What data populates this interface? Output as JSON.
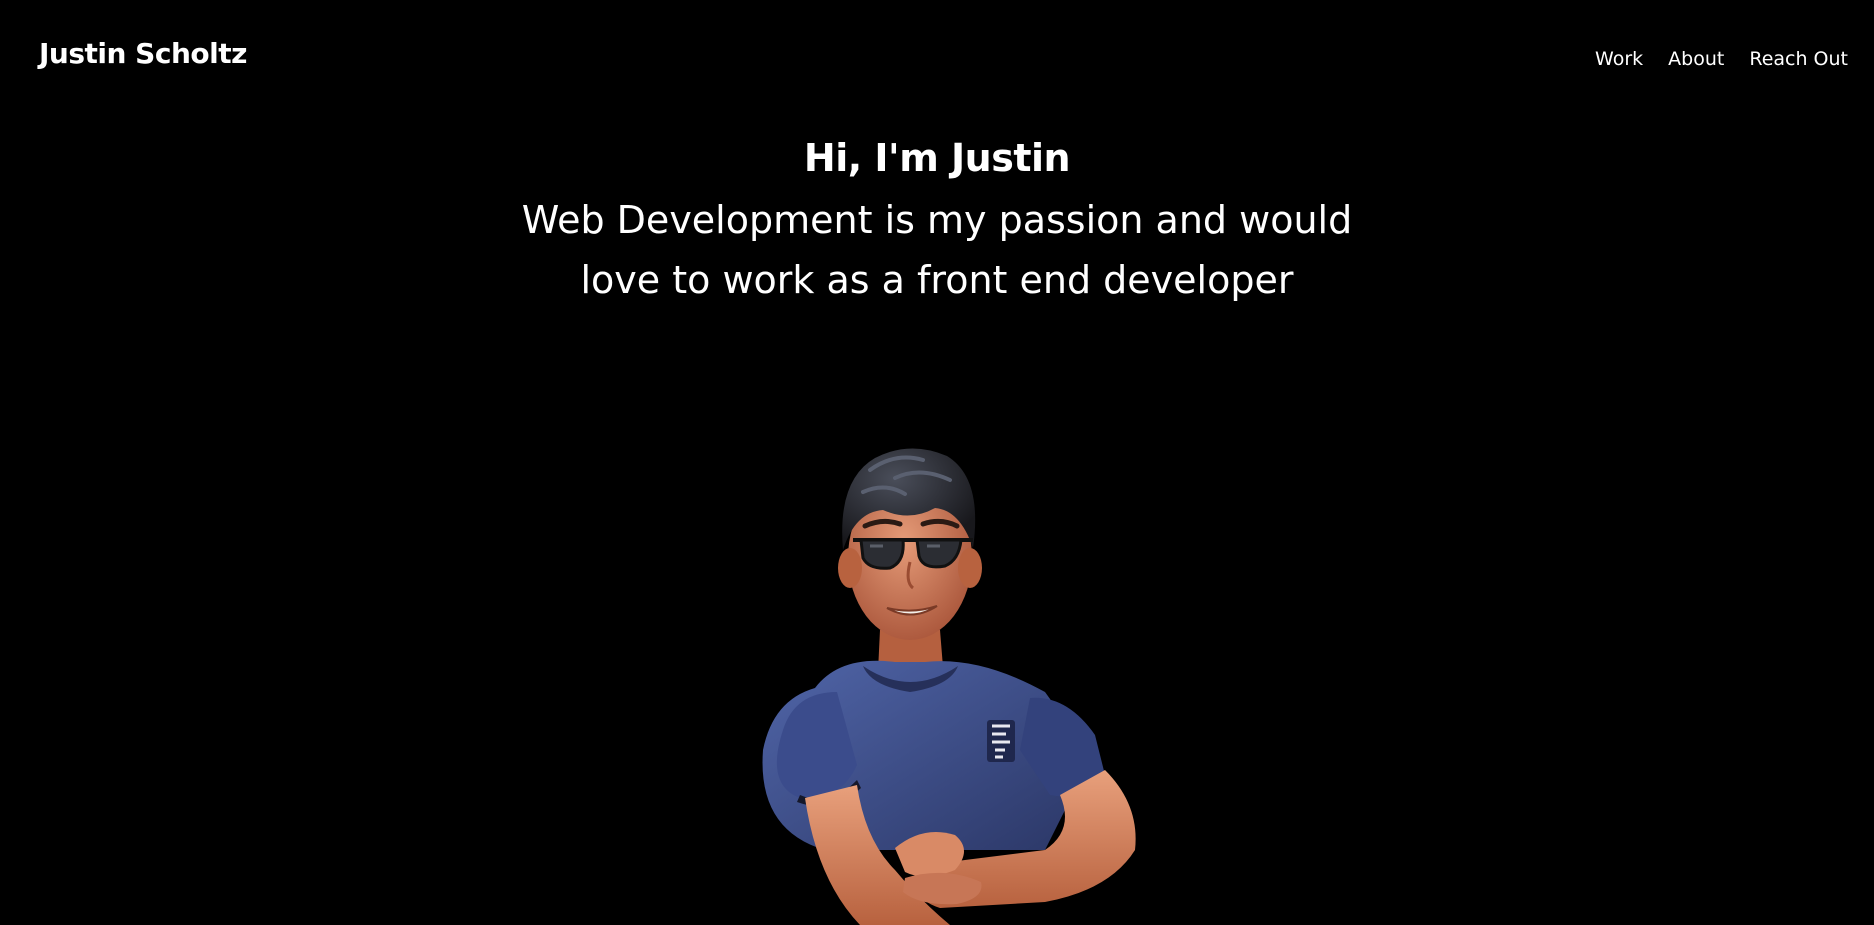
{
  "header": {
    "brand": "Justin Scholtz",
    "nav": [
      {
        "label": "Work"
      },
      {
        "label": "About"
      },
      {
        "label": "Reach Out"
      }
    ]
  },
  "hero": {
    "greeting": "Hi, I'm Justin",
    "tagline": "Web Development is my passion and would love to work as a front end developer"
  },
  "avatar": {
    "icon": "avatar-3d-figure",
    "shirt_color": "#3c4d8a",
    "skin_color": "#d07a5a",
    "hair_color": "#2a2a2f"
  }
}
